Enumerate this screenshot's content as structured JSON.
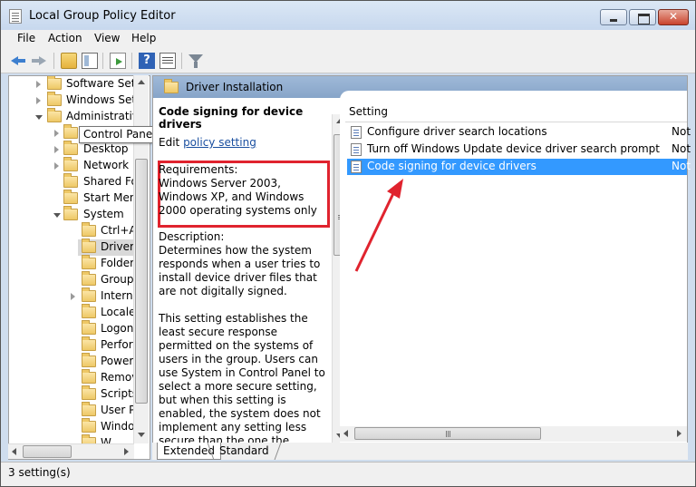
{
  "window": {
    "title": "Local Group Policy Editor"
  },
  "menu": [
    "File",
    "Action",
    "View",
    "Help"
  ],
  "toolbar": {
    "icons": [
      "back-arrow-icon",
      "forward-arrow-icon",
      "up-folder-icon",
      "show-hide-tree-icon",
      "export-list-icon",
      "help-icon",
      "properties-icon",
      "filter-icon"
    ],
    "help_label": "?"
  },
  "tree": {
    "items": [
      {
        "label": "Software Setti",
        "expander": "collapsed"
      },
      {
        "label": "Windows Sett",
        "expander": "collapsed"
      },
      {
        "label": "Administrative",
        "expander": "expanded"
      },
      {
        "label": "",
        "expander": "collapsed"
      },
      {
        "label": "Desktop",
        "expander": "collapsed"
      },
      {
        "label": "Network",
        "expander": "collapsed"
      },
      {
        "label": "Shared Fol",
        "expander": "none"
      },
      {
        "label": "Start Menu",
        "expander": "none"
      },
      {
        "label": "System",
        "expander": "expanded"
      },
      {
        "label": "Ctrl+A",
        "expander": "none"
      },
      {
        "label": "Driver",
        "expander": "none",
        "selected": true
      },
      {
        "label": "Folder",
        "expander": "none"
      },
      {
        "label": "Group",
        "expander": "none"
      },
      {
        "label": "Interne",
        "expander": "collapsed"
      },
      {
        "label": "Locale",
        "expander": "none"
      },
      {
        "label": "Logon",
        "expander": "none"
      },
      {
        "label": "Perfor",
        "expander": "none"
      },
      {
        "label": "Power",
        "expander": "none"
      },
      {
        "label": "Remov",
        "expander": "none"
      },
      {
        "label": "Scripts",
        "expander": "none"
      },
      {
        "label": "User Pr",
        "expander": "none"
      },
      {
        "label": "Windo",
        "expander": "none"
      },
      {
        "label": "W",
        "expander": "none"
      }
    ],
    "tooltip": "Control Panel"
  },
  "header": {
    "title": "Driver Installation"
  },
  "description": {
    "title": "Code signing for device drivers",
    "edit_prefix": "Edit ",
    "edit_link": "policy setting",
    "requirements_label": "Requirements:",
    "requirements_text": "Windows Server 2003, Windows XP, and Windows 2000 operating systems only",
    "description_label": "Description:",
    "description_text": "Determines how the system responds when a user tries to install device driver files that are not digitally signed.",
    "description_text_2": "This setting establishes the least secure response permitted on the systems of users in the group. Users can use System in Control Panel to select a more secure setting, but when this setting is enabled, the system does not implement any setting less secure than the one the setting established."
  },
  "settings": {
    "column_header": "Setting",
    "rows": [
      {
        "name": "Configure driver search locations",
        "state": "Not",
        "selected": false
      },
      {
        "name": "Turn off Windows Update device driver search prompt",
        "state": "Not",
        "selected": false
      },
      {
        "name": "Code signing for device drivers",
        "state": "Not",
        "selected": true
      }
    ]
  },
  "tabs": [
    "Extended",
    "Standard"
  ],
  "status": {
    "text": "3 setting(s)"
  },
  "colors": {
    "selection": "#3399ff",
    "highlight_box": "#e0232e",
    "arrow": "#e0232e",
    "link": "#1a4fa0"
  }
}
